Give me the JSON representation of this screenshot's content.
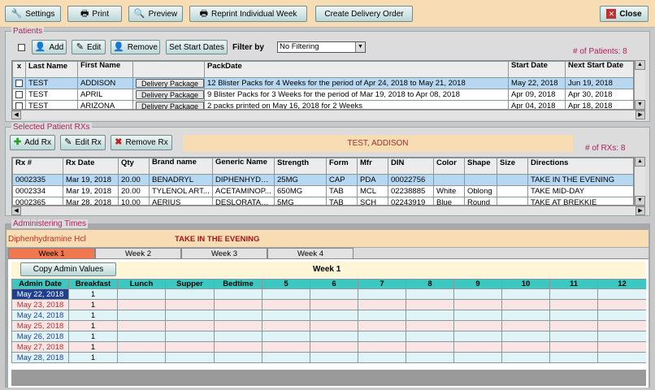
{
  "toolbar": {
    "settings": "Settings",
    "print": "Print",
    "preview": "Preview",
    "reprint": "Reprint Individual Week",
    "create_delivery": "Create Delivery Order",
    "close": "Close"
  },
  "patients": {
    "title": "Patients",
    "add": "Add",
    "edit": "Edit",
    "remove": "Remove",
    "set_start_dates": "Set Start Dates",
    "filter_label": "Filter by",
    "filter_value": "No Filtering",
    "count_label": "# of Patients: 8",
    "headers": [
      "x",
      "Last Name",
      "First Name",
      "",
      "PackDate",
      "Start Date",
      "Next Start Date"
    ],
    "rows": [
      {
        "last": "TEST",
        "first": "ADDISON",
        "btn": "Delivery Package",
        "pack": "12 Blister Packs for 4 Weeks for the period of Apr 24, 2018 to May 21, 2018",
        "start": "May 22, 2018",
        "next": "Jun 19, 2018"
      },
      {
        "last": "TEST",
        "first": "APRIL",
        "btn": "Delivery Package",
        "pack": "9 Blister Packs for 3 Weeks for the period of Mar 19, 2018 to Apr 08, 2018",
        "start": "Apr 09, 2018",
        "next": "Apr 30, 2018"
      },
      {
        "last": "TEST",
        "first": "ARIZONA",
        "btn": "Delivery Package",
        "pack": "2 packs printed on May 16, 2018 for 2 Weeks",
        "start": "Apr 04, 2018",
        "next": "Apr 18, 2018"
      }
    ]
  },
  "rx": {
    "title": "Selected Patient RXs",
    "add": "Add Rx",
    "edit": "Edit Rx",
    "remove": "Remove Rx",
    "patient_name": "TEST, ADDISON",
    "count_label": "# of RXs: 8",
    "headers": [
      "Rx #",
      "Rx Date",
      "Qty",
      "Brand name",
      "Generic Name",
      "Strength",
      "Form",
      "Mfr",
      "DIN",
      "Color",
      "Shape",
      "Size",
      "Directions"
    ],
    "rows": [
      {
        "rx": "0002335",
        "date": "Mar 19, 2018",
        "qty": "20.00",
        "brand": "BENADRYL",
        "generic": "DIPHENHYDR...",
        "strength": "25MG",
        "form": "CAP",
        "mfr": "PDA",
        "din": "00022756",
        "color": "",
        "shape": "",
        "size": "",
        "dir": "TAKE IN THE EVENING"
      },
      {
        "rx": "0002334",
        "date": "Mar 19, 2018",
        "qty": "20.00",
        "brand": "TYLENOL ART...",
        "generic": "ACETAMINOP...",
        "strength": "650MG",
        "form": "TAB",
        "mfr": "MCL",
        "din": "02238885",
        "color": "White",
        "shape": "Oblong",
        "size": "",
        "dir": "TAKE MID-DAY"
      },
      {
        "rx": "0002365",
        "date": "Mar 28, 2018",
        "qty": "10.00",
        "brand": "AERIUS",
        "generic": "DESLORATADI...",
        "strength": "5MG",
        "form": "TAB",
        "mfr": "SCH",
        "din": "02243919",
        "color": "Blue",
        "shape": "Round",
        "size": "",
        "dir": "TAKE AT BREKKIE"
      }
    ]
  },
  "admin": {
    "title": "Administering Times",
    "drug": "Diphenhydramine Hcl",
    "direction": "TAKE IN THE EVENING",
    "tabs": [
      "Week 1",
      "Week 2",
      "Week 3",
      "Week 4"
    ],
    "copy_btn": "Copy Admin Values",
    "week_label": "Week 1",
    "headers": [
      "Admin Date",
      "Breakfast",
      "Lunch",
      "Supper",
      "Bedtime",
      "5",
      "6",
      "7",
      "8",
      "9",
      "10",
      "11",
      "12"
    ],
    "rows": [
      {
        "date": "May 22, 2018",
        "breakfast": "1"
      },
      {
        "date": "May 23, 2018",
        "breakfast": "1"
      },
      {
        "date": "May 24, 2018",
        "breakfast": "1"
      },
      {
        "date": "May 25, 2018",
        "breakfast": "1"
      },
      {
        "date": "May 26, 2018",
        "breakfast": "1"
      },
      {
        "date": "May 27, 2018",
        "breakfast": "1"
      },
      {
        "date": "May 28, 2018",
        "breakfast": "1"
      }
    ]
  },
  "colors": {
    "accent": "#b0205f",
    "highlight": "#b7d8f0",
    "header_teal": "#3cc8c0",
    "banner": "#f7dcb4"
  }
}
